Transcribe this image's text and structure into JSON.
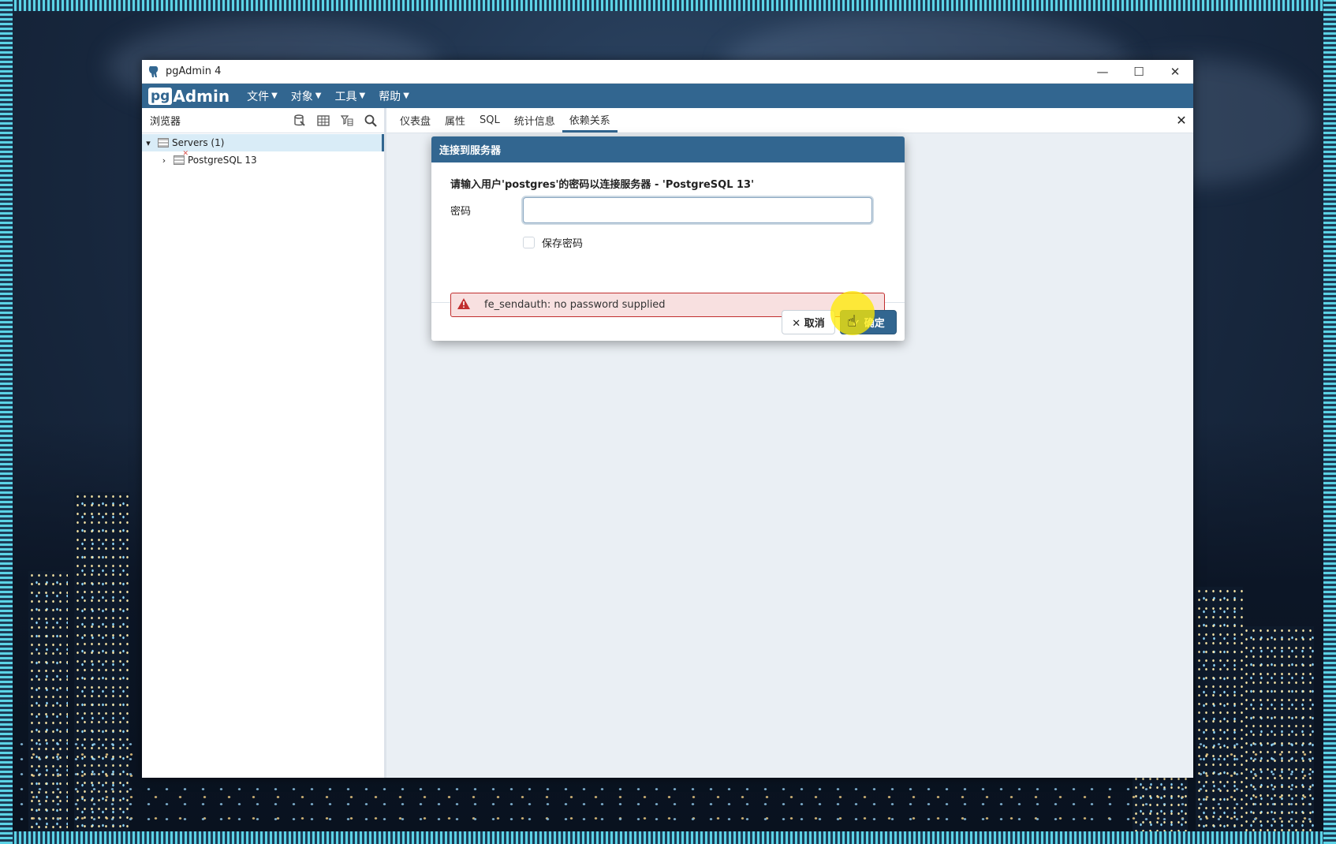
{
  "window": {
    "title": "pgAdmin 4",
    "controls": {
      "minimize": "—",
      "maximize": "☐",
      "close": "✕"
    }
  },
  "brand": {
    "pg": "pg",
    "admin": "Admin"
  },
  "menu": {
    "items": [
      {
        "label": "文件"
      },
      {
        "label": "对象"
      },
      {
        "label": "工具"
      },
      {
        "label": "帮助"
      }
    ]
  },
  "browser": {
    "title": "浏览器",
    "tools": [
      "query-tool-icon",
      "view-data-icon",
      "filter-icon",
      "search-icon"
    ],
    "tree": [
      {
        "label": "Servers (1)",
        "expanded": true
      },
      {
        "label": "PostgreSQL 13",
        "expanded": false,
        "disconnected": true
      }
    ]
  },
  "tabs": {
    "items": [
      "仪表盘",
      "属性",
      "SQL",
      "统计信息",
      "依赖关系"
    ],
    "active": "依赖关系",
    "close": "✕"
  },
  "dialog": {
    "title": "连接到服务器",
    "prompt": "请输入用户'postgres'的密码以连接服务器 - 'PostgreSQL 13'",
    "password_label": "密码",
    "password_value": "",
    "save_password_label": "保存密码",
    "save_password_checked": false,
    "error_text": "fe_sendauth: no password supplied",
    "cancel_label": "✕ 取消",
    "ok_label": "✓ 确定"
  },
  "colors": {
    "brand": "#326690",
    "error_border": "#c12e2e",
    "error_bg": "#f8e0e0",
    "selection": "#d9ecf7"
  }
}
